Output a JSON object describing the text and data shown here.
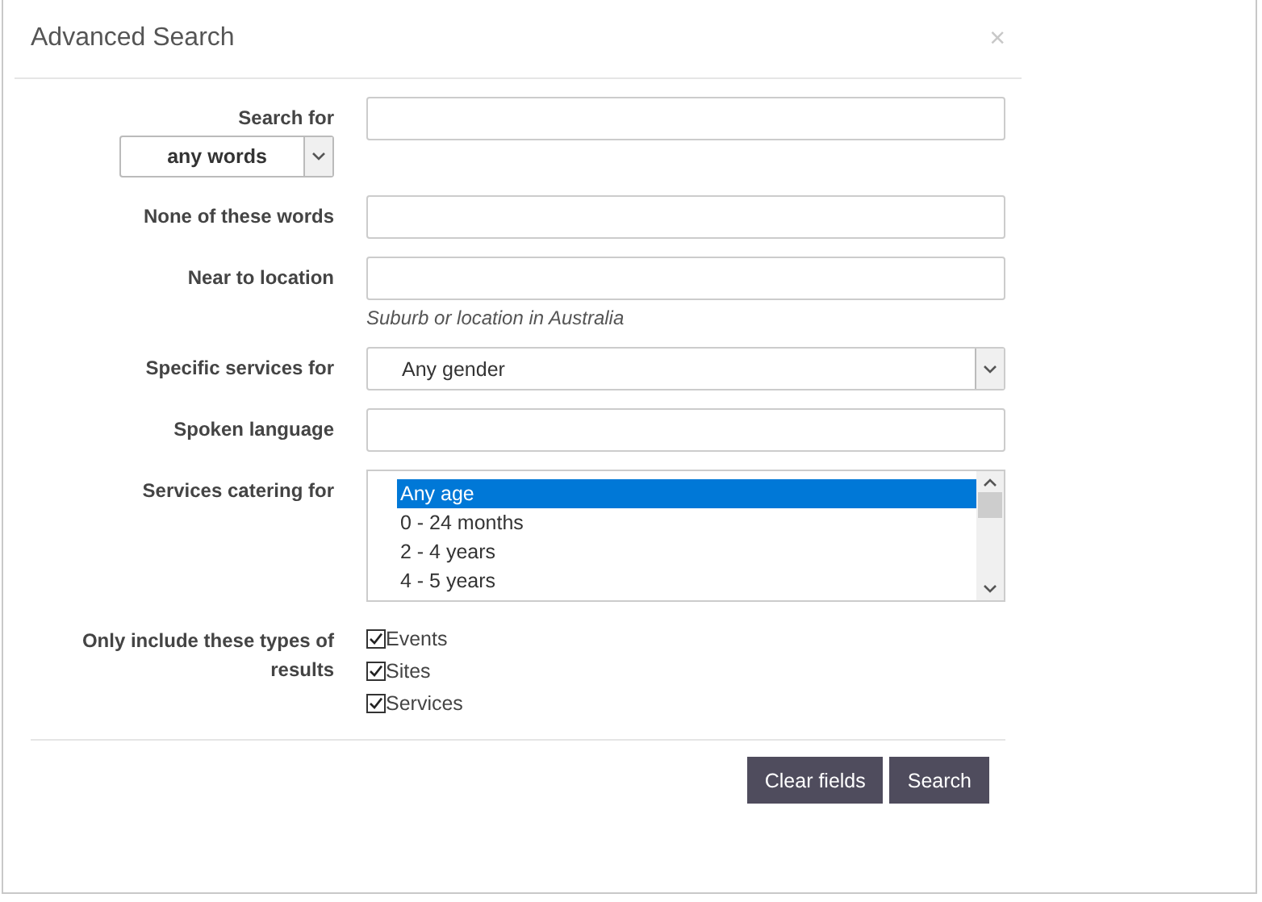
{
  "dialog": {
    "title": "Advanced Search",
    "close": "×"
  },
  "fields": [
    {
      "kind": "text",
      "label": "Search for",
      "mode_select": {
        "value": "any words"
      }
    },
    {
      "kind": "text",
      "label": "None of these words"
    },
    {
      "kind": "text",
      "label": "Near to location",
      "help": "Suburb or location in Australia"
    },
    {
      "kind": "select",
      "label": "Specific services for",
      "value": "Any gender"
    },
    {
      "kind": "text",
      "label": "Spoken language"
    },
    {
      "kind": "listbox",
      "label": "Services catering for",
      "options": [
        {
          "label": "Any age",
          "selected": true
        },
        {
          "label": "0 - 24 months",
          "selected": false
        },
        {
          "label": "2 - 4 years",
          "selected": false
        },
        {
          "label": "4 - 5 years",
          "selected": false
        }
      ]
    },
    {
      "kind": "checkboxes",
      "label": "Only include these types of results",
      "options": [
        {
          "label": "Events",
          "checked": true
        },
        {
          "label": "Sites",
          "checked": true
        },
        {
          "label": "Services",
          "checked": true
        }
      ]
    }
  ],
  "buttons": [
    {
      "label": "Clear fields"
    },
    {
      "label": "Search"
    }
  ]
}
